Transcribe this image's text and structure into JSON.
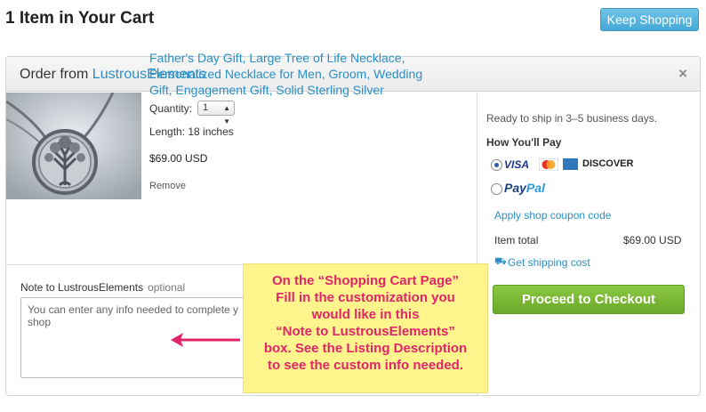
{
  "page": {
    "title": "1 Item in Your Cart"
  },
  "header": {
    "keep_shopping": "Keep Shopping"
  },
  "order": {
    "prefix": "Order from",
    "shop_name": "LustrousElements",
    "close": "×"
  },
  "product": {
    "title_lines": [
      "Father's Day Gift, Large Tree of Life Necklace,",
      "Personalized Necklace for Men, Groom, Wedding",
      "Gift, Engagement Gift, Solid Sterling Silver"
    ],
    "quantity_label": "Quantity:",
    "quantity_value": "1",
    "length": "Length: 18 inches",
    "price": "$69.00 USD",
    "remove": "Remove"
  },
  "note": {
    "label": "Note to LustrousElements",
    "optional": "optional",
    "placeholder_lines": [
      "You can enter any info needed to complete y",
      "shop"
    ]
  },
  "payment": {
    "ready": "Ready to ship in 3–5 business days.",
    "how_pay": "How You'll Pay",
    "visa": "VISA",
    "discover": "DISCOVER",
    "paypal_pay": "Pay",
    "paypal_pal": "Pal",
    "coupon": "Apply shop coupon code",
    "item_total_label": "Item total",
    "item_total_value": "$69.00 USD",
    "shipping": "Get shipping cost",
    "checkout": "Proceed to Checkout"
  },
  "callout": {
    "lines": [
      "On the “Shopping Cart Page”",
      "Fill in the customization you",
      "would like in this",
      "“Note to LustrousElements”",
      "box. See the Listing Description",
      "to see the custom info needed."
    ]
  },
  "colors": {
    "link": "#2a8fc4",
    "checkout": "#7ab834",
    "callout_bg": "#fff58c",
    "callout_text": "#e0256a"
  },
  "icons": {
    "close": "close-icon",
    "truck": "truck-icon",
    "arrow": "arrow-left-icon"
  }
}
